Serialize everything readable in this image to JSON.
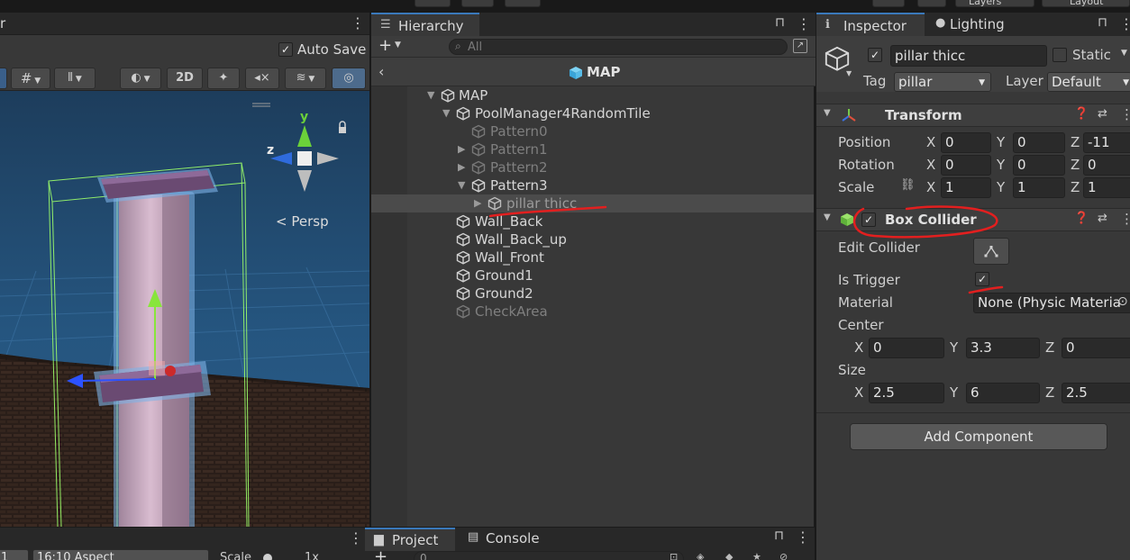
{
  "scene": {
    "tab_label": "r",
    "auto_save_label": "Auto Save",
    "auto_save_checked": "✓",
    "btn_2d": "2D",
    "persp_label": "Persp",
    "axis_x": "x",
    "axis_y": "y",
    "axis_z": "z",
    "aspect_label": "16:10 Aspect",
    "scale_label": "Scale",
    "scale_value": "1x",
    "display_label": "1"
  },
  "hierarchy": {
    "tab_label": "Hierarchy",
    "search_placeholder": "All",
    "scene_name": "MAP",
    "items": [
      {
        "label": "MAP"
      },
      {
        "label": "PoolManager4RandomTile"
      },
      {
        "label": "Pattern0"
      },
      {
        "label": "Pattern1"
      },
      {
        "label": "Pattern2"
      },
      {
        "label": "Pattern3"
      },
      {
        "label": "pillar thicc"
      },
      {
        "label": "Wall_Back"
      },
      {
        "label": "Wall_Back_up"
      },
      {
        "label": "Wall_Front"
      },
      {
        "label": "Ground1"
      },
      {
        "label": "Ground2"
      },
      {
        "label": "CheckArea"
      }
    ]
  },
  "project": {
    "tab_project": "Project",
    "tab_console": "Console",
    "search_value": "0"
  },
  "inspector": {
    "tab_inspector": "Inspector",
    "tab_lighting": "Lighting",
    "object_name": "pillar thicc",
    "static_label": "Static",
    "tag_label": "Tag",
    "tag_value": "pillar",
    "layer_label": "Layer",
    "layer_value": "Default",
    "check": "✓",
    "transform": {
      "title": "Transform",
      "position_label": "Position",
      "rotation_label": "Rotation",
      "scale_label": "Scale",
      "x": "X",
      "y": "Y",
      "z": "Z",
      "position": [
        "0",
        "0",
        "-11"
      ],
      "rotation": [
        "0",
        "0",
        "0"
      ],
      "scale": [
        "1",
        "1",
        "1"
      ]
    },
    "box_collider": {
      "title": "Box Collider",
      "edit_collider_label": "Edit Collider",
      "is_trigger_label": "Is Trigger",
      "material_label": "Material",
      "material_value": "None (Physic Materia",
      "center_label": "Center",
      "size_label": "Size",
      "center": [
        "0",
        "3.3",
        "0"
      ],
      "size": [
        "2.5",
        "6",
        "2.5"
      ]
    },
    "add_component_label": "Add Component"
  },
  "top_strip": {
    "layers_label": "Layers",
    "layout_label": "Layout"
  },
  "colors": {
    "accent": "#3a79bb",
    "annotation_red": "#e21f1f",
    "selection_outline": "#7fb3e6",
    "bounds_green": "#9dff6a"
  }
}
